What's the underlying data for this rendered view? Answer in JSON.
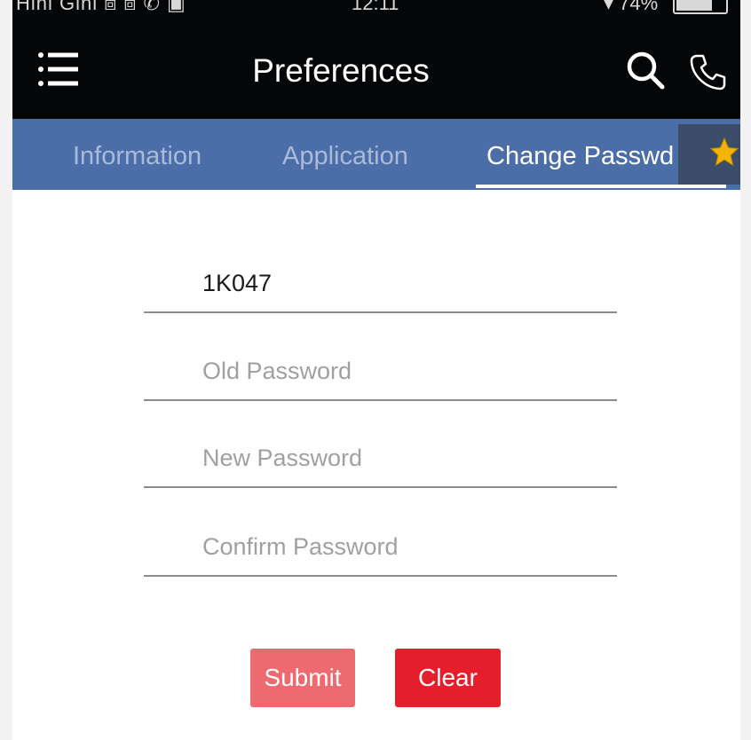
{
  "status_bar": {
    "left_text": "Hini Gini ⧈ ⧈ ✆ ▣",
    "time": "12:11",
    "right_text": "▾ 74%",
    "battery_level": 0.74
  },
  "toolbar": {
    "title": "Preferences",
    "menu_icon": "menu-icon",
    "search_icon": "search-icon",
    "phone_icon": "phone-icon"
  },
  "tabs": [
    {
      "label": "Information",
      "active": false
    },
    {
      "label": "Application",
      "active": false
    },
    {
      "label": "Change Passwd",
      "active": true
    }
  ],
  "tab_overlay_icon": "star-icon",
  "form": {
    "user_id": {
      "value": "1K047",
      "placeholder": ""
    },
    "old_password": {
      "value": "",
      "placeholder": "Old Password"
    },
    "new_password": {
      "value": "",
      "placeholder": "New Password"
    },
    "confirm_password": {
      "value": "",
      "placeholder": "Confirm Password"
    }
  },
  "buttons": {
    "submit_label": "Submit",
    "clear_label": "Clear"
  },
  "colors": {
    "toolbar": "#050608",
    "tab_bar": "#4b6ea8",
    "submit": "#ec6a70",
    "clear": "#e41e2b"
  }
}
